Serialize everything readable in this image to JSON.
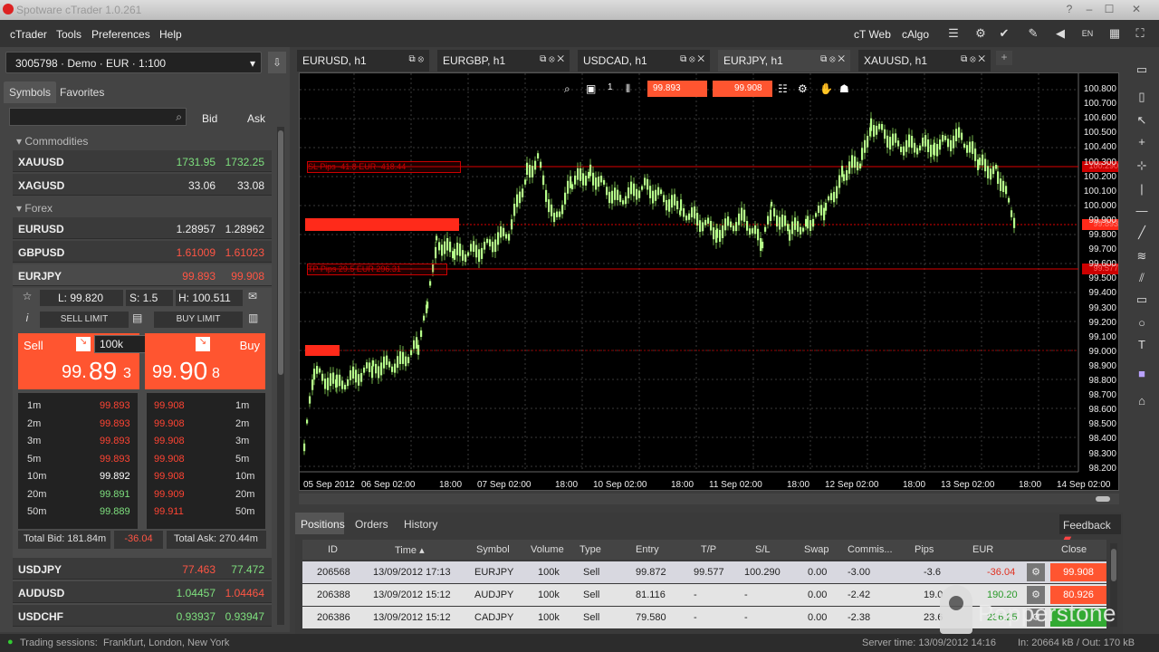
{
  "window": {
    "title": "Spotware cTrader 1.0.261"
  },
  "menu": [
    "cTrader",
    "Tools",
    "Preferences",
    "Help"
  ],
  "top_right": {
    "ctweb": "cT Web",
    "calgo": "cAlgo"
  },
  "account": "3005798 · Demo · EUR · 1:100",
  "left_tabs": [
    "Symbols",
    "Favorites"
  ],
  "bid_label": "Bid",
  "ask_label": "Ask",
  "groups": {
    "commodities": "Commodities",
    "forex": "Forex"
  },
  "commodities": [
    {
      "sym": "XAUUSD",
      "bid": "1731.95",
      "ask": "1732.25"
    },
    {
      "sym": "XAGUSD",
      "bid": "33.06",
      "ask": "33.08"
    }
  ],
  "forex": [
    {
      "sym": "EURUSD",
      "bid": "1.28957",
      "ask": "1.28962"
    },
    {
      "sym": "GBPUSD",
      "bid": "1.61009",
      "ask": "1.61023"
    },
    {
      "sym": "EURJPY",
      "bid": "99.893",
      "ask": "99.908"
    }
  ],
  "forex_lower": [
    {
      "sym": "USDJPY",
      "bid": "77.463",
      "ask": "77.472"
    },
    {
      "sym": "AUDUSD",
      "bid": "1.04457",
      "ask": "1.04464"
    },
    {
      "sym": "USDCHF",
      "bid": "0.93937",
      "ask": "0.93947"
    }
  ],
  "deal": {
    "low": "L: 99.820",
    "spread": "S: 1.5",
    "high": "H: 100.511",
    "sell_limit": "SELL LIMIT",
    "buy_limit": "BUY LIMIT",
    "sell": "Sell",
    "buy": "Buy",
    "volume": "100k",
    "sell_big": "99.",
    "sell_pips": "89",
    "sell_small": "3",
    "buy_big": "99.",
    "buy_pips": "90",
    "buy_small": "8"
  },
  "depth": [
    {
      "t": "1m",
      "bid": "99.893",
      "ask": "99.908"
    },
    {
      "t": "2m",
      "bid": "99.893",
      "ask": "99.908"
    },
    {
      "t": "3m",
      "bid": "99.893",
      "ask": "99.908"
    },
    {
      "t": "5m",
      "bid": "99.893",
      "ask": "99.908"
    },
    {
      "t": "10m",
      "bid": "99.892",
      "ask": "99.908"
    },
    {
      "t": "20m",
      "bid": "99.891",
      "ask": "99.909"
    },
    {
      "t": "50m",
      "bid": "99.889",
      "ask": "99.911"
    }
  ],
  "totals": {
    "bid": "Total Bid: 181.84m",
    "mid": "-36.04",
    "ask": "Total Ask: 270.44m"
  },
  "chart_tabs": [
    "EURUSD, h1",
    "EURGBP, h1",
    "USDCAD, h1",
    "EURJPY, h1",
    "XAUUSD, h1"
  ],
  "chart_toolbar": {
    "bid": "99.893",
    "ask": "99.908",
    "zoom": "1"
  },
  "chart_labels": {
    "sl": "SL",
    "sl_pips": "Pips -41.8",
    "sl_eur": "EUR -418.44",
    "tp": "TP",
    "tp_pips": "Pips 29.5",
    "tp_eur": "EUR 296.31",
    "sl_price": "100.290",
    "cur_price": "99.893",
    "tp_price": "99.577"
  },
  "prices": [
    "100.800",
    "100.700",
    "100.600",
    "100.500",
    "100.400",
    "100.300",
    "100.200",
    "100.100",
    "100.000",
    "99.900",
    "99.800",
    "99.700",
    "99.600",
    "99.500",
    "99.400",
    "99.300",
    "99.200",
    "99.100",
    "99.000",
    "98.900",
    "98.800",
    "98.700",
    "98.600",
    "98.500",
    "98.400",
    "98.300",
    "98.200"
  ],
  "times": [
    "05 Sep 2012",
    "06 Sep 02:00",
    "18:00",
    "07 Sep 02:00",
    "18:00",
    "10 Sep 02:00",
    "18:00",
    "11 Sep 02:00",
    "18:00",
    "12 Sep 02:00",
    "18:00",
    "13 Sep 02:00",
    "18:00",
    "14 Sep 02:00"
  ],
  "bottom_tabs": [
    "Positions",
    "Orders",
    "History"
  ],
  "feedback": "Feedback",
  "pos_headers": [
    "ID",
    "Time ▴",
    "Symbol",
    "Volume",
    "Type",
    "Entry",
    "T/P",
    "S/L",
    "Swap",
    "Commis...",
    "Pips",
    "EUR",
    "Close"
  ],
  "positions": [
    {
      "id": "206568",
      "time": "13/09/2012 17:13",
      "sym": "EURJPY",
      "vol": "100k",
      "type": "Sell",
      "entry": "99.872",
      "tp": "99.577",
      "sl": "100.290",
      "swap": "0.00",
      "comm": "-3.00",
      "pips": "-3.6",
      "eur": "-36.04",
      "close": "99.908"
    },
    {
      "id": "206388",
      "time": "13/09/2012 15:12",
      "sym": "AUDJPY",
      "vol": "100k",
      "type": "Sell",
      "entry": "81.116",
      "tp": "-",
      "sl": "-",
      "swap": "0.00",
      "comm": "-2.42",
      "pips": "19.0",
      "eur": "190.20",
      "close": "80.926"
    },
    {
      "id": "206386",
      "time": "13/09/2012 15:12",
      "sym": "CADJPY",
      "vol": "100k",
      "type": "Sell",
      "entry": "79.580",
      "tp": "-",
      "sl": "-",
      "swap": "0.00",
      "comm": "-2.38",
      "pips": "23.6",
      "eur": "236.25",
      "close": ""
    }
  ],
  "status": {
    "sessions": "Trading sessions:",
    "cities": "Frankfurt, London, New York",
    "server": "Server time: 13/09/2012 14:16",
    "io": "In: 20664 kB / Out: 170 kB"
  },
  "brand": "Pepperstone"
}
